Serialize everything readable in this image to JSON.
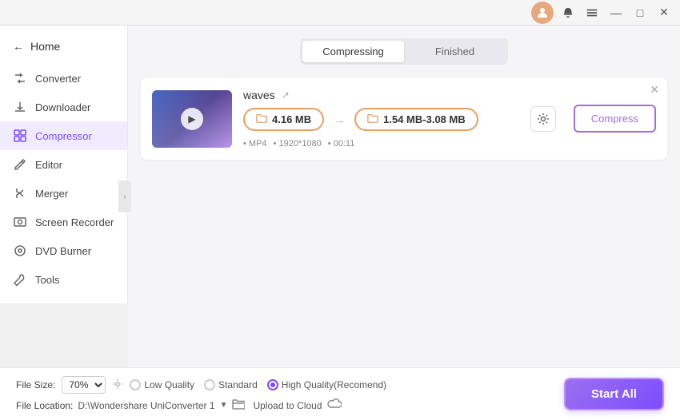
{
  "titlebar": {
    "minimize_label": "—",
    "maximize_label": "□",
    "close_label": "✕",
    "menu_label": "☰",
    "notification_label": "🔔"
  },
  "sidebar": {
    "home_label": "Home",
    "items": [
      {
        "id": "converter",
        "label": "Converter",
        "icon": "⇄"
      },
      {
        "id": "downloader",
        "label": "Downloader",
        "icon": "⬇"
      },
      {
        "id": "compressor",
        "label": "Compressor",
        "icon": "⊞",
        "active": true
      },
      {
        "id": "editor",
        "label": "Editor",
        "icon": "✏"
      },
      {
        "id": "merger",
        "label": "Merger",
        "icon": "⊕"
      },
      {
        "id": "screen-recorder",
        "label": "Screen Recorder",
        "icon": "⏺"
      },
      {
        "id": "dvd-burner",
        "label": "DVD Burner",
        "icon": "💿"
      },
      {
        "id": "tools",
        "label": "Tools",
        "icon": "🔧"
      }
    ]
  },
  "tabs": {
    "compressing_label": "Compressing",
    "finished_label": "Finished"
  },
  "file_card": {
    "filename": "waves",
    "close_label": "✕",
    "original_size": "4.16 MB",
    "compressed_size": "1.54 MB-3.08 MB",
    "meta_format": "MP4",
    "meta_resolution": "1920*1080",
    "meta_duration": "00:11",
    "settings_icon": "⚙",
    "compress_label": "Compress"
  },
  "bottom_bar": {
    "file_size_label": "File Size:",
    "file_size_value": "70%",
    "quality_options": [
      {
        "label": "Low Quality",
        "selected": false
      },
      {
        "label": "Standard",
        "selected": false
      },
      {
        "label": "High Quality(Recomend)",
        "selected": true
      }
    ],
    "file_location_label": "File Location:",
    "location_path": "D:\\Wondershare UniConverter 1",
    "upload_cloud_label": "Upload to Cloud",
    "start_all_label": "Start All"
  },
  "colors": {
    "accent": "#7c4dff",
    "orange": "#e8a060",
    "sidebar_active_bg": "#f0ebff"
  }
}
